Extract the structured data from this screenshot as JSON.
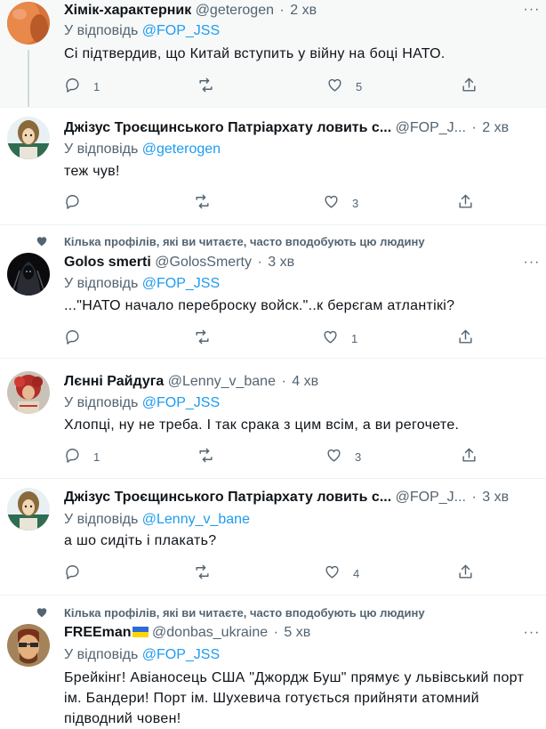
{
  "social_context_text": "Кілька профілів, які ви читаєте, часто вподобують цю людину",
  "tweets": [
    {
      "name": "Хімік-характерник",
      "handle": "@geterogen",
      "time": "2 хв",
      "reply_prefix": "У відповідь",
      "reply_to": "@FOP_JSS",
      "text": "Сі підтвердив, що Китай вступить у війну на боці НАТО.",
      "replies": "1",
      "retweets": "",
      "likes": "5"
    },
    {
      "name": "Джізус Троєщинського Патріархату ловить с...",
      "handle": "@FOP_J...",
      "time": "2 хв",
      "reply_prefix": "У відповідь",
      "reply_to": "@geterogen",
      "text": "теж чув!",
      "replies": "",
      "retweets": "",
      "likes": "3"
    },
    {
      "name": "Golos smerti",
      "handle": "@GolosSmerty",
      "time": "3 хв",
      "reply_prefix": "У відповідь",
      "reply_to": "@FOP_JSS",
      "text": "...\"НАТО начало переброску войск.\"..к берєгам атлантікі?",
      "replies": "",
      "retweets": "",
      "likes": "1"
    },
    {
      "name": "Лєнні Райдуга",
      "handle": "@Lenny_v_bane",
      "time": "4 хв",
      "reply_prefix": "У відповідь",
      "reply_to": "@FOP_JSS",
      "text": "Хлопці, ну не треба. І так срака з цим всім, а ви регочете.",
      "replies": "1",
      "retweets": "",
      "likes": "3"
    },
    {
      "name": "Джізус Троєщинського Патріархату ловить с...",
      "handle": "@FOP_J...",
      "time": "3 хв",
      "reply_prefix": "У відповідь",
      "reply_to": "@Lenny_v_bane",
      "text": "а шо сидіть і плакать?",
      "replies": "",
      "retweets": "",
      "likes": "4"
    },
    {
      "name": "FREEman",
      "handle": "@donbas_ukraine",
      "time": "5 хв",
      "reply_prefix": "У відповідь",
      "reply_to": "@FOP_JSS",
      "text": "Брейкінг! Авіаносець США \"Джордж Буш\" прямує у львівський порт ім. Бандери! Порт ім. Шухевича готується прийняти атомний підводний човен!",
      "replies": "",
      "retweets": "",
      "likes": ""
    }
  ],
  "icons": {
    "reply": "reply-icon",
    "retweet": "retweet-icon",
    "like": "heart-icon",
    "share": "share-icon",
    "more": "more-icon",
    "flag": "ukraine-flag-icon"
  },
  "colors": {
    "text": "#0f1419",
    "secondary": "#536471",
    "mention": "#1d9bf0",
    "separator": "#eff3f4",
    "shaded_background": "#f7f9f9"
  }
}
